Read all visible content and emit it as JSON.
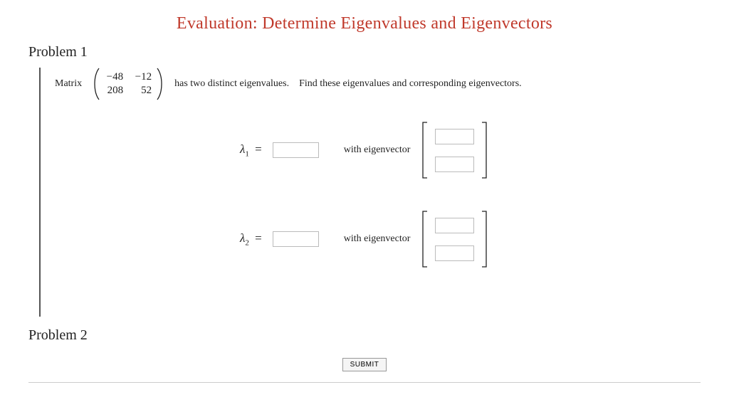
{
  "title": "Evaluation: Determine Eigenvalues and Eigenvectors",
  "problem1": {
    "heading": "Problem 1",
    "matrix_label": "Matrix",
    "matrix": {
      "a11": "−48",
      "a12": "−12",
      "a21": "208",
      "a22": "52"
    },
    "prompt_part1": "has two distinct eigenvalues.",
    "prompt_part2": "Find these eigenvalues and corresponding eigenvectors.",
    "lambda1_symbol": "λ",
    "lambda1_sub": "1",
    "lambda2_symbol": "λ",
    "lambda2_sub": "2",
    "equals": " =",
    "with_eigenvector": "with eigenvector",
    "lambda1_value": "",
    "lambda2_value": "",
    "v1_top": "",
    "v1_bot": "",
    "v2_top": "",
    "v2_bot": ""
  },
  "problem2": {
    "heading": "Problem 2"
  },
  "submit_label": "SUBMIT"
}
